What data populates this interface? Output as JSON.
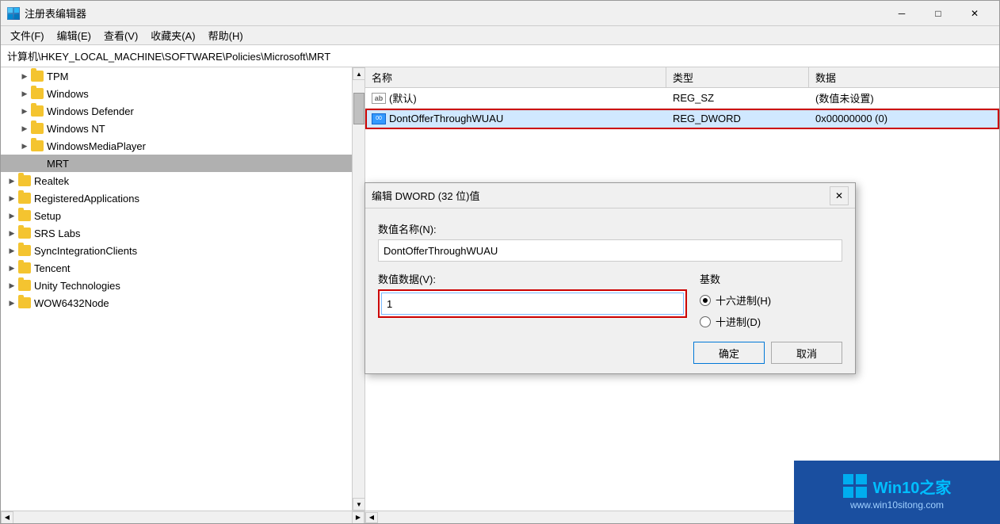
{
  "window": {
    "title": "注册表编辑器",
    "icon": "regedit"
  },
  "title_controls": {
    "minimize": "─",
    "maximize": "□",
    "close": "✕"
  },
  "menu": {
    "items": [
      "文件(F)",
      "编辑(E)",
      "查看(V)",
      "收藏夹(A)",
      "帮助(H)"
    ]
  },
  "address_bar": {
    "path": "计算机\\HKEY_LOCAL_MACHINE\\SOFTWARE\\Policies\\Microsoft\\MRT"
  },
  "tree": {
    "items": [
      {
        "label": "TPM",
        "indent": 1,
        "hasArrow": true,
        "type": "folder"
      },
      {
        "label": "Windows",
        "indent": 1,
        "hasArrow": true,
        "type": "folder"
      },
      {
        "label": "Windows Defender",
        "indent": 1,
        "hasArrow": true,
        "type": "folder"
      },
      {
        "label": "Windows NT",
        "indent": 1,
        "hasArrow": true,
        "type": "folder"
      },
      {
        "label": "WindowsMediaPlayer",
        "indent": 1,
        "hasArrow": true,
        "type": "folder"
      },
      {
        "label": "MRT",
        "indent": 1,
        "hasArrow": false,
        "type": "folder",
        "selected": true
      },
      {
        "label": "Realtek",
        "indent": 0,
        "hasArrow": true,
        "type": "folder"
      },
      {
        "label": "RegisteredApplications",
        "indent": 0,
        "hasArrow": true,
        "type": "folder"
      },
      {
        "label": "Setup",
        "indent": 0,
        "hasArrow": true,
        "type": "folder"
      },
      {
        "label": "SRS Labs",
        "indent": 0,
        "hasArrow": true,
        "type": "folder"
      },
      {
        "label": "SyncIntegrationClients",
        "indent": 0,
        "hasArrow": true,
        "type": "folder"
      },
      {
        "label": "Tencent",
        "indent": 0,
        "hasArrow": true,
        "type": "folder"
      },
      {
        "label": "Unity Technologies",
        "indent": 0,
        "hasArrow": true,
        "type": "folder"
      },
      {
        "label": "WOW6432Node",
        "indent": 0,
        "hasArrow": true,
        "type": "folder"
      }
    ]
  },
  "table": {
    "headers": {
      "name": "名称",
      "type": "类型",
      "data": "数据"
    },
    "rows": [
      {
        "name": "(默认)",
        "icon": "ab",
        "type": "REG_SZ",
        "data": "(数值未设置)"
      },
      {
        "name": "DontOfferThroughWUAU",
        "icon": "dword",
        "type": "REG_DWORD",
        "data": "0x00000000 (0)",
        "highlighted": true
      }
    ]
  },
  "dialog": {
    "title": "编辑 DWORD (32 位)值",
    "name_label": "数值名称(N):",
    "name_value": "DontOfferThroughWUAU",
    "value_label": "数值数据(V):",
    "value_input": "1",
    "base_label": "基数",
    "radios": [
      {
        "label": "十六进制(H)",
        "checked": true
      },
      {
        "label": "十进制(D)",
        "checked": false
      }
    ],
    "ok_label": "确定",
    "cancel_label": "取消"
  },
  "watermark": {
    "title_start": "Win10",
    "title_colored": "之家",
    "url": "www.win10sitong.com"
  }
}
